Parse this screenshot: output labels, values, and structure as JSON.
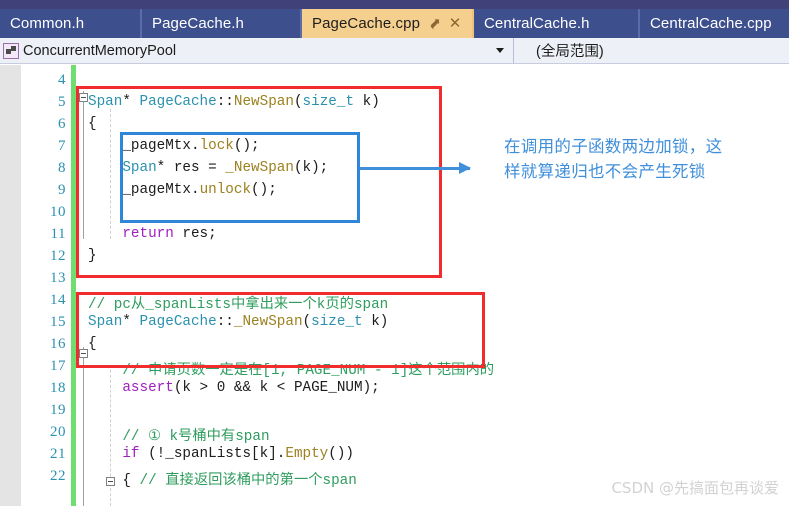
{
  "window": {
    "accent_tab_active_bg": "#f5cf8e",
    "tabbar_bg": "#41528f",
    "top_strip_bg": "#41417a"
  },
  "tabs": [
    {
      "label": "Common.h",
      "active": false
    },
    {
      "label": "PageCache.h",
      "active": false
    },
    {
      "label": "PageCache.cpp",
      "active": true,
      "pin_icon": "pin-icon",
      "close_icon": "close-icon"
    },
    {
      "label": "CentralCache.h",
      "active": false
    },
    {
      "label": "CentralCache.cpp",
      "active": false
    }
  ],
  "nav_bar": {
    "namespace_icon": "namespace-icon",
    "scope_combo_value": "ConcurrentMemoryPool",
    "dropdown_icon": "chevron-down-icon",
    "member_combo_value": "(全局范围)"
  },
  "editor": {
    "line_numbers": [
      "4",
      "5",
      "6",
      "7",
      "8",
      "9",
      "10",
      "11",
      "12",
      "13",
      "14",
      "15",
      "16",
      "17",
      "18",
      "19",
      "20",
      "21",
      "22"
    ],
    "lines": [
      {
        "num": "4",
        "text": ""
      },
      {
        "num": "5",
        "text": "Span* PageCache::NewSpan(size_t k)"
      },
      {
        "num": "6",
        "text": "{"
      },
      {
        "num": "7",
        "text": "    _pageMtx.lock();"
      },
      {
        "num": "8",
        "text": "    Span* res = _NewSpan(k);"
      },
      {
        "num": "9",
        "text": "    _pageMtx.unlock();"
      },
      {
        "num": "10",
        "text": ""
      },
      {
        "num": "11",
        "text": "    return res;"
      },
      {
        "num": "12",
        "text": "}"
      },
      {
        "num": "13",
        "text": ""
      },
      {
        "num": "14",
        "text": "// pc从_spanLists中拿出来一个k页的span"
      },
      {
        "num": "15",
        "text": "Span* PageCache::_NewSpan(size_t k)"
      },
      {
        "num": "16",
        "text": "{"
      },
      {
        "num": "17",
        "text": "    // 申请页数一定是在[1, PAGE_NUM - 1]这个范围内的"
      },
      {
        "num": "18",
        "text": "    assert(k > 0 && k < PAGE_NUM);"
      },
      {
        "num": "19",
        "text": ""
      },
      {
        "num": "20",
        "text": "    // ① k号桶中有span"
      },
      {
        "num": "21",
        "text": "    if (!_spanLists[k].Empty())"
      },
      {
        "num": "22",
        "text": "    { // 直接返回该桶中的第一个span"
      }
    ],
    "tokens": {
      "l5": [
        [
          "Span",
          "t-type"
        ],
        [
          "* ",
          "t-plain"
        ],
        [
          "PageCache",
          "t-type"
        ],
        [
          "::",
          "t-plain"
        ],
        [
          "NewSpan",
          "t-func"
        ],
        [
          "(",
          "t-plain"
        ],
        [
          "size_t",
          "t-type"
        ],
        [
          " k)",
          "t-plain"
        ]
      ],
      "l6": [
        [
          "{",
          "t-plain"
        ]
      ],
      "l7": [
        [
          "    _pageMtx",
          "t-plain"
        ],
        [
          ".",
          "t-plain"
        ],
        [
          "lock",
          "t-func"
        ],
        [
          "();",
          "t-plain"
        ]
      ],
      "l8": [
        [
          "    ",
          "t-plain"
        ],
        [
          "Span",
          "t-type"
        ],
        [
          "* res = ",
          "t-plain"
        ],
        [
          "_NewSpan",
          "t-func"
        ],
        [
          "(k);",
          "t-plain"
        ]
      ],
      "l9": [
        [
          "    _pageMtx",
          "t-plain"
        ],
        [
          ".",
          "t-plain"
        ],
        [
          "unlock",
          "t-func"
        ],
        [
          "();",
          "t-plain"
        ]
      ],
      "l11": [
        [
          "    ",
          "t-plain"
        ],
        [
          "return",
          "t-kw"
        ],
        [
          " res;",
          "t-plain"
        ]
      ],
      "l12": [
        [
          "}",
          "t-plain"
        ]
      ],
      "l14": [
        [
          "// pc从_spanLists中拿出来一个k页的span",
          "t-cmt"
        ]
      ],
      "l15": [
        [
          "Span",
          "t-type"
        ],
        [
          "* ",
          "t-plain"
        ],
        [
          "PageCache",
          "t-type"
        ],
        [
          "::",
          "t-plain"
        ],
        [
          "_NewSpan",
          "t-func"
        ],
        [
          "(",
          "t-plain"
        ],
        [
          "size_t",
          "t-type"
        ],
        [
          " k)",
          "t-plain"
        ]
      ],
      "l16": [
        [
          "{",
          "t-plain"
        ]
      ],
      "l17": [
        [
          "    // 申请页数一定是在[1, PAGE_NUM - 1]这个范围内的",
          "t-cmt"
        ]
      ],
      "l18": [
        [
          "    ",
          "t-plain"
        ],
        [
          "assert",
          "t-kw"
        ],
        [
          "(k > ",
          "t-plain"
        ],
        [
          "0",
          "t-plain"
        ],
        [
          " && k < PAGE_NUM);",
          "t-plain"
        ]
      ],
      "l20": [
        [
          "    // ① k号桶中有span",
          "t-cmt"
        ]
      ],
      "l21": [
        [
          "    ",
          "t-plain"
        ],
        [
          "if",
          "t-kw"
        ],
        [
          " (!_spanLists[k].",
          "t-plain"
        ],
        [
          "Empty",
          "t-func"
        ],
        [
          "())",
          "t-plain"
        ]
      ],
      "l22": [
        [
          "    { ",
          "t-plain"
        ],
        [
          "// 直接返回该桶中的第一个span",
          "t-cmt"
        ]
      ]
    }
  },
  "annotations": {
    "red_box_color": "#f22c2c",
    "blue_box_color": "#2f86d8",
    "arrow_color": "#3f8fdb",
    "note_text": "在调用的子函数两边加锁，这\n样就算递归也不会产生死锁"
  },
  "watermark": {
    "text": "CSDN @先搞面包再谈爱"
  }
}
